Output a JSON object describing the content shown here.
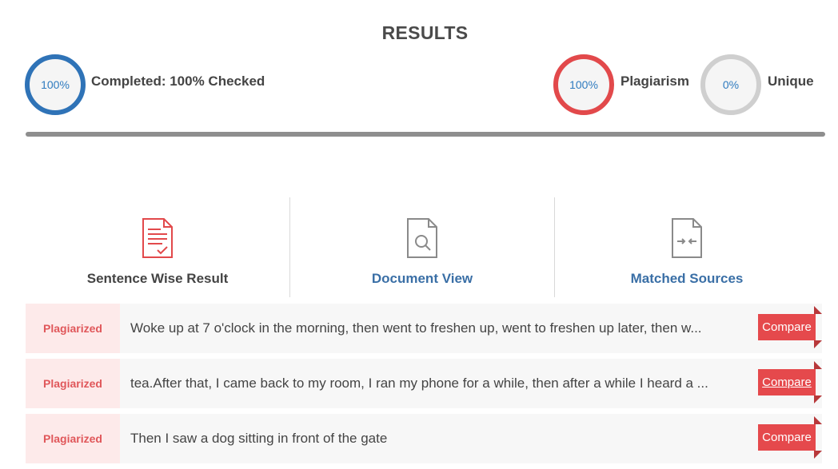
{
  "header": {
    "title": "RESULTS"
  },
  "stats": {
    "completed": {
      "value": "100%",
      "label": "Completed: 100% Checked",
      "color": "#2f73b7"
    },
    "plagiarism": {
      "value": "100%",
      "label": "Plagiarism",
      "color": "#e2494b"
    },
    "unique": {
      "value": "0%",
      "label": "Unique",
      "color": "#cfcfcf"
    }
  },
  "progress": {
    "fraction": 1.0
  },
  "tabs": [
    {
      "label": "Sentence Wise Result",
      "icon": "document-check-icon",
      "active": true
    },
    {
      "label": "Document View",
      "icon": "document-search-icon",
      "active": false
    },
    {
      "label": "Matched Sources",
      "icon": "document-compare-icon",
      "active": false
    }
  ],
  "results": [
    {
      "status": "Plagiarized",
      "text": "Woke up at 7 o'clock in the morning, then went to freshen up, went to freshen up later, then w...",
      "action": "Compare"
    },
    {
      "status": "Plagiarized",
      "text": "tea.After that, I came back to my room, I ran my phone for a while, then after a while I heard a ...",
      "action": "Compare"
    },
    {
      "status": "Plagiarized",
      "text": "Then I saw a dog sitting in front of the gate",
      "action": "Compare"
    }
  ],
  "colors": {
    "accent_red": "#e5494c",
    "accent_blue": "#2f73b7",
    "status_bg": "#fdeaea"
  }
}
